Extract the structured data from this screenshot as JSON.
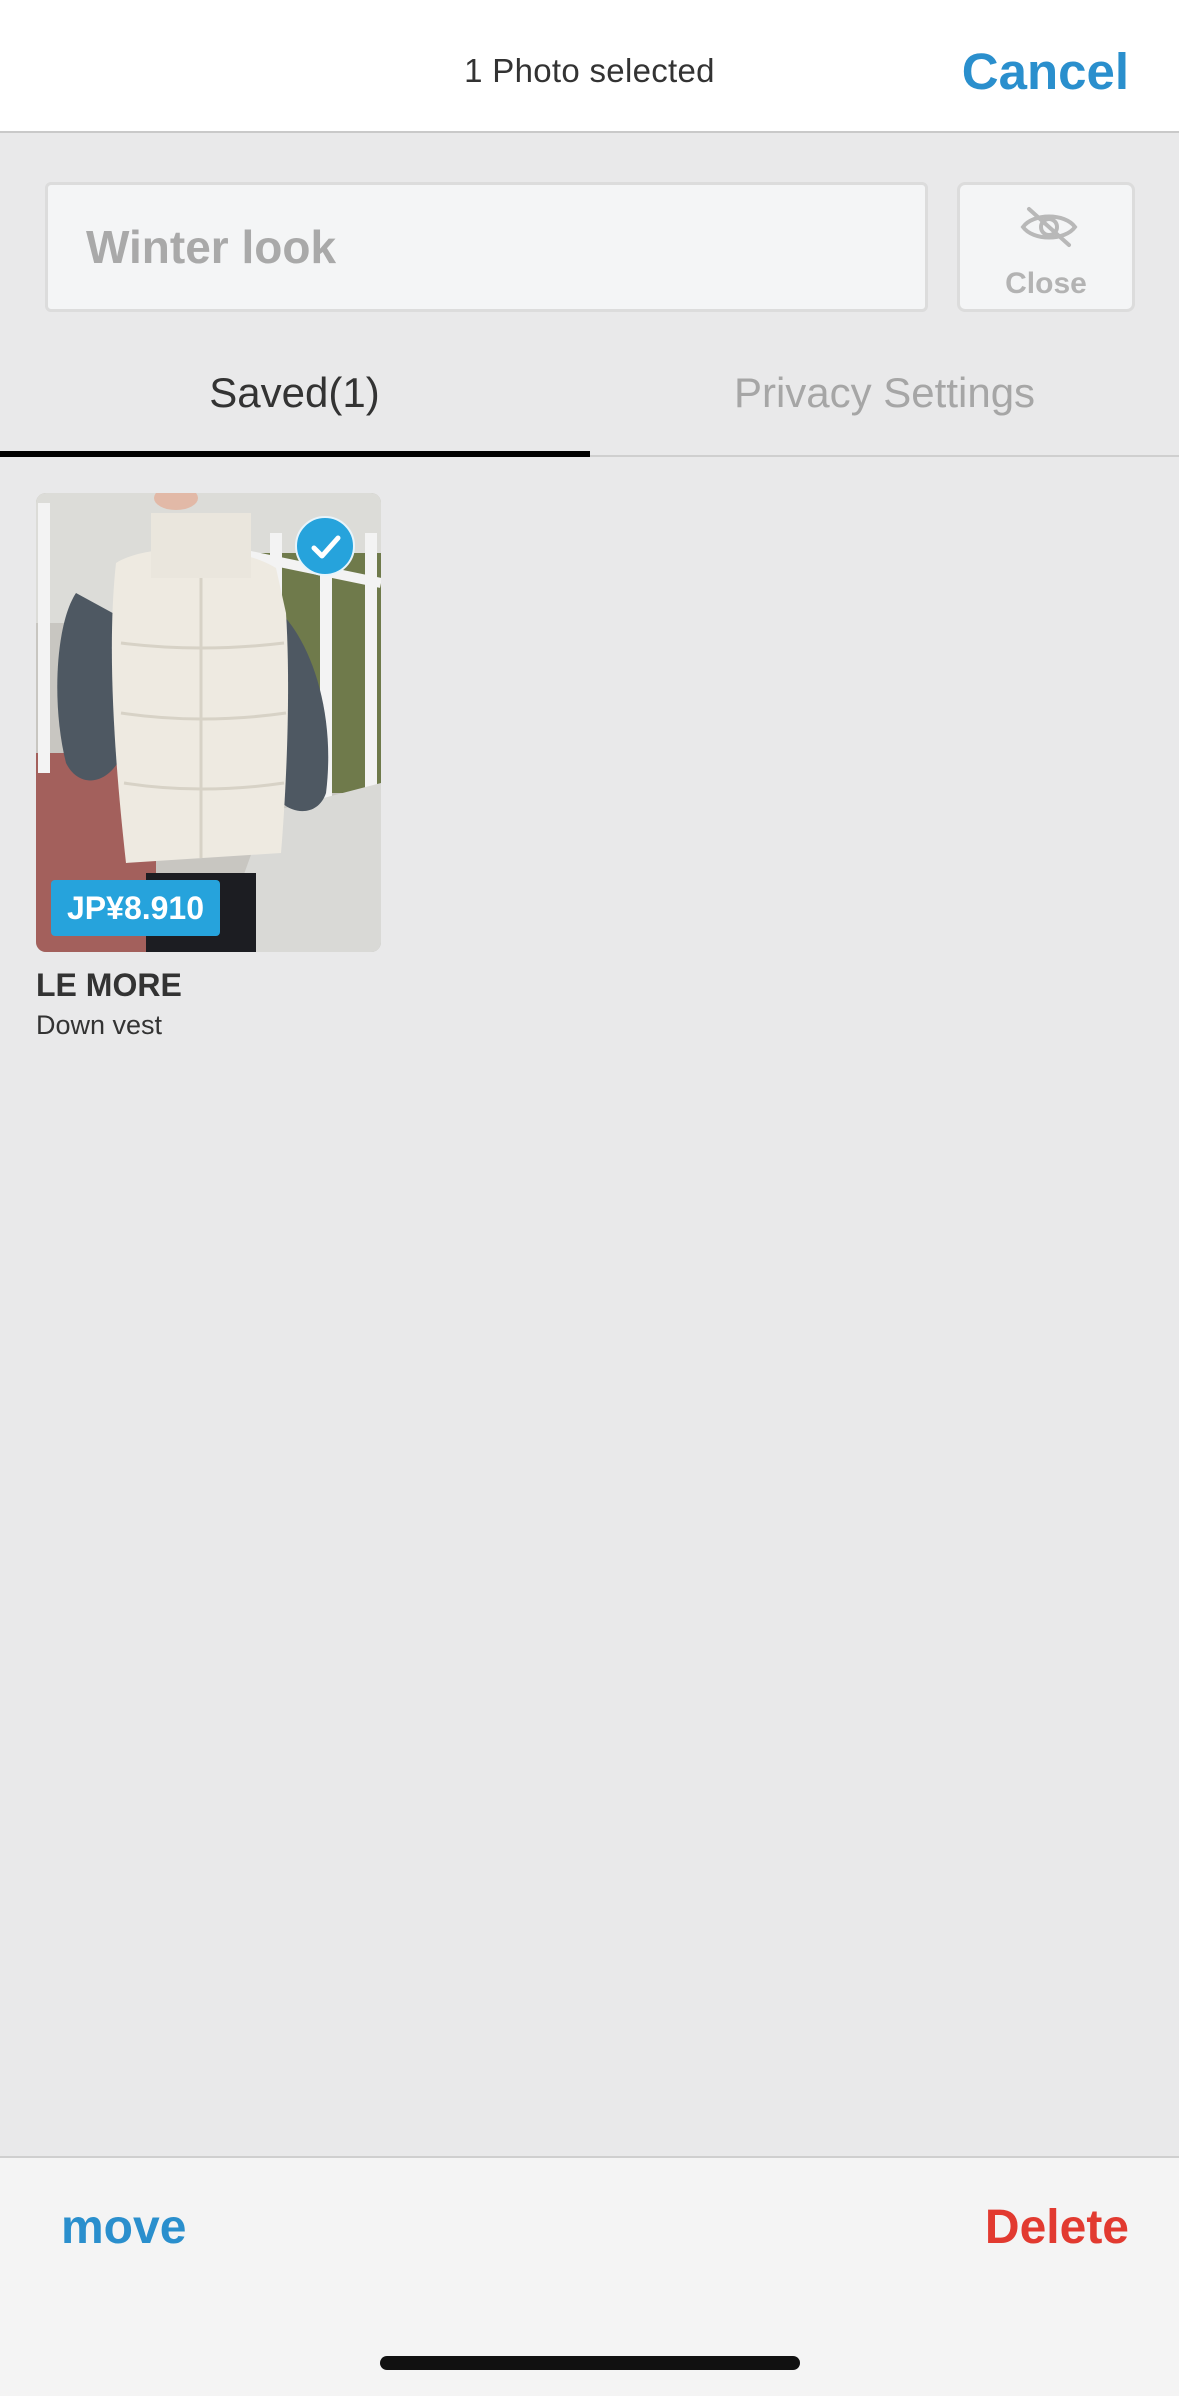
{
  "header": {
    "title": "1 Photo selected",
    "cancel_label": "Cancel"
  },
  "name_field": {
    "placeholder": "Winter look"
  },
  "close_button": {
    "icon": "eye-off-icon",
    "label": "Close"
  },
  "tabs": [
    {
      "label": "Saved(1)",
      "active": true
    },
    {
      "label": "Privacy Settings",
      "active": false
    }
  ],
  "items": [
    {
      "price": "JP¥8.910",
      "brand": "LE MORE",
      "name": "Down vest",
      "selected": true
    }
  ],
  "footer": {
    "move_label": "move",
    "delete_label": "Delete"
  },
  "colors": {
    "accent": "#2a8fcd",
    "badge": "#26a3dc",
    "danger": "#e23a30"
  }
}
